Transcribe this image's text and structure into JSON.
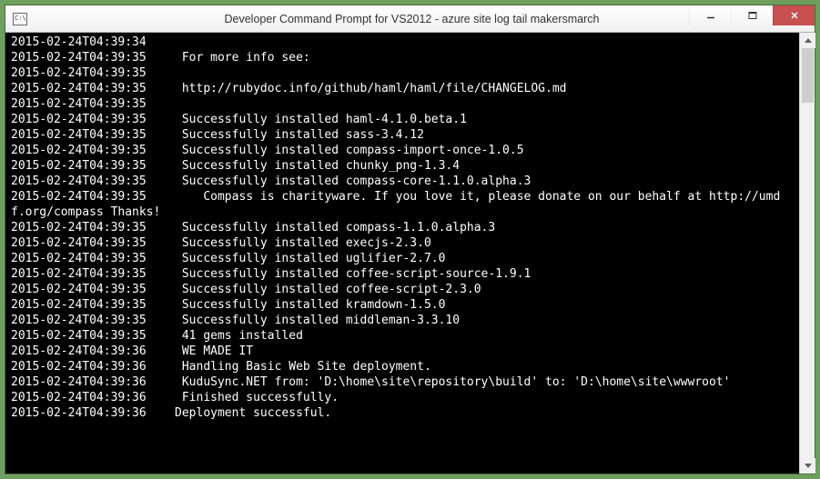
{
  "window": {
    "title": "Developer Command Prompt for VS2012 - azure  site log tail makersmarch"
  },
  "lines": [
    {
      "ts": "2015-02-24T04:39:34",
      "msg": ""
    },
    {
      "ts": "2015-02-24T04:39:35",
      "msg": "   For more info see:"
    },
    {
      "ts": "2015-02-24T04:39:35",
      "msg": ""
    },
    {
      "ts": "2015-02-24T04:39:35",
      "msg": "   http://rubydoc.info/github/haml/haml/file/CHANGELOG.md"
    },
    {
      "ts": "2015-02-24T04:39:35",
      "msg": ""
    },
    {
      "ts": "2015-02-24T04:39:35",
      "msg": "   Successfully installed haml-4.1.0.beta.1"
    },
    {
      "ts": "2015-02-24T04:39:35",
      "msg": "   Successfully installed sass-3.4.12"
    },
    {
      "ts": "2015-02-24T04:39:35",
      "msg": "   Successfully installed compass-import-once-1.0.5"
    },
    {
      "ts": "2015-02-24T04:39:35",
      "msg": "   Successfully installed chunky_png-1.3.4"
    },
    {
      "ts": "2015-02-24T04:39:35",
      "msg": "   Successfully installed compass-core-1.1.0.alpha.3"
    },
    {
      "raw": "2015-02-24T04:39:35        Compass is charityware. If you love it, please donate on our behalf at http://umd"
    },
    {
      "raw": "f.org/compass Thanks!"
    },
    {
      "ts": "2015-02-24T04:39:35",
      "msg": "   Successfully installed compass-1.1.0.alpha.3"
    },
    {
      "ts": "2015-02-24T04:39:35",
      "msg": "   Successfully installed execjs-2.3.0"
    },
    {
      "ts": "2015-02-24T04:39:35",
      "msg": "   Successfully installed uglifier-2.7.0"
    },
    {
      "ts": "2015-02-24T04:39:35",
      "msg": "   Successfully installed coffee-script-source-1.9.1"
    },
    {
      "ts": "2015-02-24T04:39:35",
      "msg": "   Successfully installed coffee-script-2.3.0"
    },
    {
      "ts": "2015-02-24T04:39:35",
      "msg": "   Successfully installed kramdown-1.5.0"
    },
    {
      "ts": "2015-02-24T04:39:35",
      "msg": "   Successfully installed middleman-3.3.10"
    },
    {
      "ts": "2015-02-24T04:39:35",
      "msg": "   41 gems installed"
    },
    {
      "ts": "2015-02-24T04:39:36",
      "msg": "   WE MADE IT"
    },
    {
      "ts": "2015-02-24T04:39:36",
      "msg": "   Handling Basic Web Site deployment."
    },
    {
      "ts": "2015-02-24T04:39:36",
      "msg": "   KuduSync.NET from: 'D:\\home\\site\\repository\\build' to: 'D:\\home\\site\\wwwroot'"
    },
    {
      "ts": "2015-02-24T04:39:36",
      "msg": "   Finished successfully."
    },
    {
      "ts": "2015-02-24T04:39:36",
      "msg": "  Deployment successful."
    }
  ]
}
